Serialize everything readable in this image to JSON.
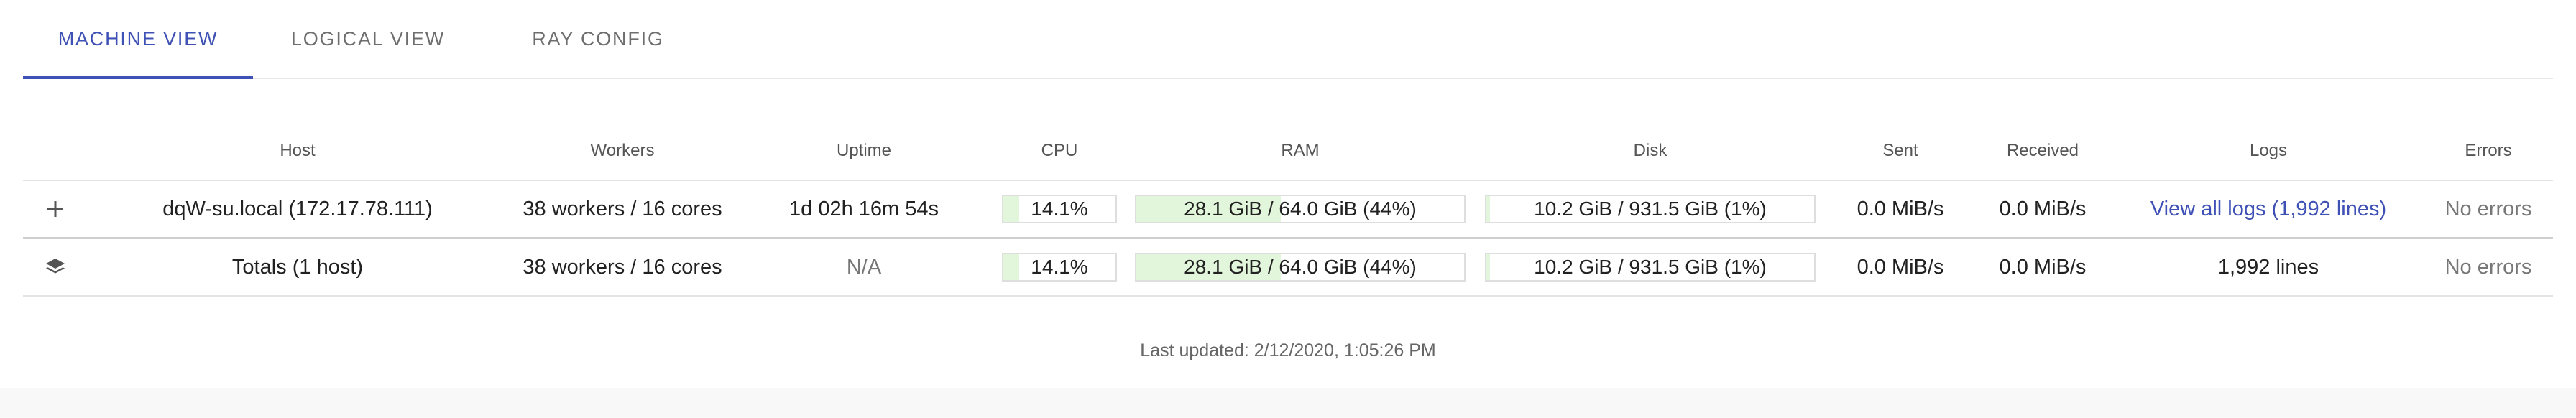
{
  "tabs": [
    {
      "label": "MACHINE VIEW",
      "active": true
    },
    {
      "label": "LOGICAL VIEW",
      "active": false
    },
    {
      "label": "RAY CONFIG",
      "active": false
    }
  ],
  "table": {
    "headers": {
      "host": "Host",
      "workers": "Workers",
      "uptime": "Uptime",
      "cpu": "CPU",
      "ram": "RAM",
      "disk": "Disk",
      "sent": "Sent",
      "received": "Received",
      "logs": "Logs",
      "errors": "Errors"
    },
    "rows": [
      {
        "expand_icon": "plus-icon",
        "host": "dqW-su.local (172.17.78.111)",
        "workers": "38 workers / 16 cores",
        "uptime": "1d 02h 16m 54s",
        "cpu": "14.1%",
        "cpu_fraction": 0.141,
        "ram": "28.1 GiB / 64.0 GiB (44%)",
        "ram_fraction": 0.44,
        "disk": "10.2 GiB / 931.5 GiB (1%)",
        "disk_fraction": 0.01,
        "sent": "0.0 MiB/s",
        "received": "0.0 MiB/s",
        "logs": "View all logs (1,992 lines)",
        "errors": "No errors"
      }
    ],
    "totals": {
      "icon": "layers-icon",
      "host": "Totals (1 host)",
      "workers": "38 workers / 16 cores",
      "uptime": "N/A",
      "cpu": "14.1%",
      "cpu_fraction": 0.141,
      "ram": "28.1 GiB / 64.0 GiB (44%)",
      "ram_fraction": 0.44,
      "disk": "10.2 GiB / 931.5 GiB (1%)",
      "disk_fraction": 0.01,
      "sent": "0.0 MiB/s",
      "received": "0.0 MiB/s",
      "logs": "1,992 lines",
      "errors": "No errors"
    }
  },
  "last_updated": "Last updated: 2/12/2020, 1:05:26 PM",
  "colors": {
    "accent": "#3f51b5",
    "bar_fill": "#e2f6dc"
  }
}
